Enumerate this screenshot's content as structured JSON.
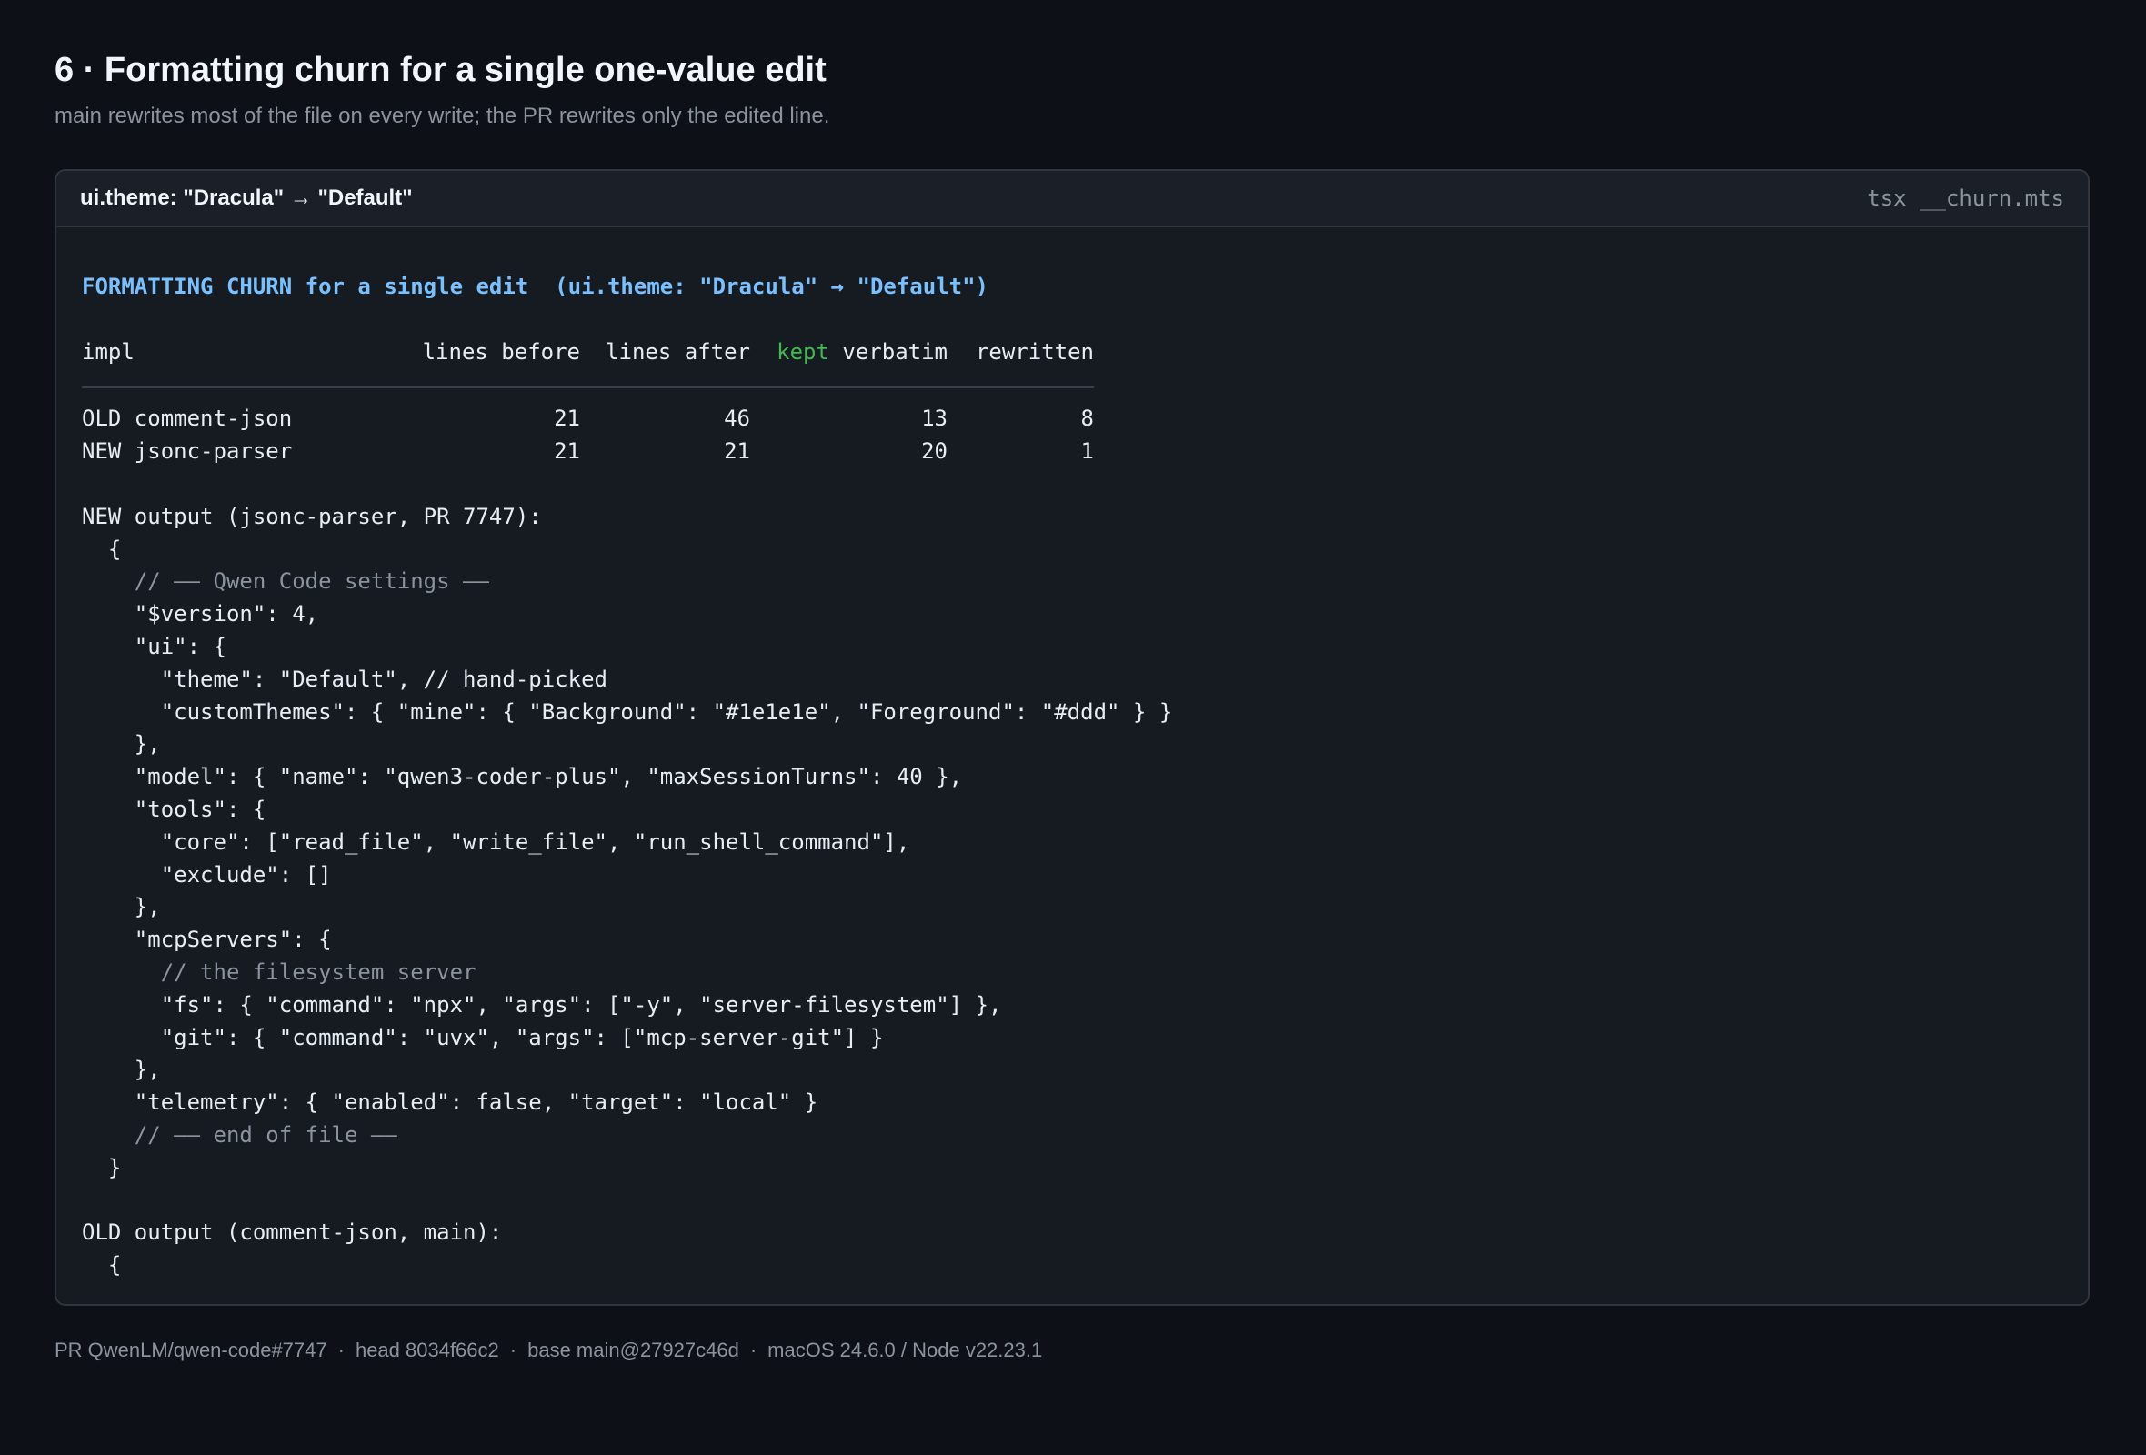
{
  "page": {
    "title": "6 · Formatting churn for a single one-value edit",
    "subtitle": "main rewrites most of the file on every write; the PR rewrites only the edited line."
  },
  "panel": {
    "title": "ui.theme: \"Dracula\" → \"Default\"",
    "command": "tsx __churn.mts"
  },
  "terminal": {
    "churn_title": "FORMATTING CHURN for a single edit  (ui.theme: \"Dracula\" → \"Default\")",
    "table": {
      "headers": {
        "impl": "impl",
        "lines_before": "lines before",
        "lines_after": "lines after",
        "kept": "kept",
        "verbatim": " verbatim",
        "rewritten": "rewritten"
      },
      "rows": [
        {
          "impl": "OLD comment-json",
          "lines_before": "21",
          "lines_after": "46",
          "kept_verbatim": "13",
          "rewritten": "8"
        },
        {
          "impl": "NEW jsonc-parser",
          "lines_before": "21",
          "lines_after": "21",
          "kept_verbatim": "20",
          "rewritten": "1"
        }
      ]
    },
    "new_output_label": "NEW output (jsonc-parser, PR 7747):",
    "new_output_lines": [
      {
        "text": "  {",
        "comment": false
      },
      {
        "text": "    // —— Qwen Code settings ——",
        "comment": true
      },
      {
        "text": "    \"$version\": 4,",
        "comment": false
      },
      {
        "text": "    \"ui\": {",
        "comment": false
      },
      {
        "text": "      \"theme\": \"Default\", // hand-picked",
        "comment": false
      },
      {
        "text": "      \"customThemes\": { \"mine\": { \"Background\": \"#1e1e1e\", \"Foreground\": \"#ddd\" } }",
        "comment": false
      },
      {
        "text": "    },",
        "comment": false
      },
      {
        "text": "    \"model\": { \"name\": \"qwen3-coder-plus\", \"maxSessionTurns\": 40 },",
        "comment": false
      },
      {
        "text": "    \"tools\": {",
        "comment": false
      },
      {
        "text": "      \"core\": [\"read_file\", \"write_file\", \"run_shell_command\"],",
        "comment": false
      },
      {
        "text": "      \"exclude\": []",
        "comment": false
      },
      {
        "text": "    },",
        "comment": false
      },
      {
        "text": "    \"mcpServers\": {",
        "comment": false
      },
      {
        "text": "      // the filesystem server",
        "comment": true
      },
      {
        "text": "      \"fs\": { \"command\": \"npx\", \"args\": [\"-y\", \"server-filesystem\"] },",
        "comment": false
      },
      {
        "text": "      \"git\": { \"command\": \"uvx\", \"args\": [\"mcp-server-git\"] }",
        "comment": false
      },
      {
        "text": "    },",
        "comment": false
      },
      {
        "text": "    \"telemetry\": { \"enabled\": false, \"target\": \"local\" }",
        "comment": false
      },
      {
        "text": "    // —— end of file ——",
        "comment": true
      },
      {
        "text": "  }",
        "comment": false
      }
    ],
    "old_output_label": "OLD output (comment-json, main):",
    "old_output_lines": [
      {
        "text": "  {",
        "comment": false
      }
    ]
  },
  "footer": {
    "items": [
      "PR QwenLM/qwen-code#7747",
      "head 8034f66c2",
      "base main@27927c46d",
      "macOS 24.6.0 / Node v22.23.1"
    ],
    "separator": "·"
  },
  "colors": {
    "background": "#0d1117",
    "panel": "#161b22",
    "accent_title": "#79c0ff",
    "kept_green": "#3fb950",
    "comment_gray": "#8b949e"
  }
}
